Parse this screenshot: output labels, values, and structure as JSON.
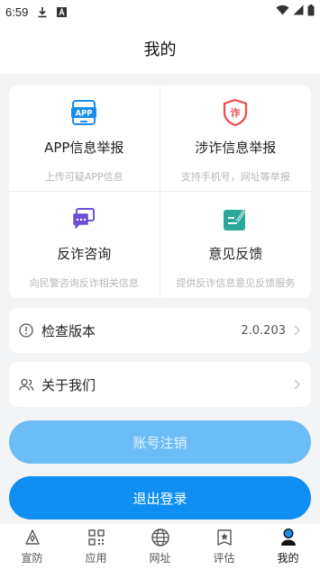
{
  "status_bar": {
    "time": "6:59",
    "icons": [
      "download-icon",
      "font-a-icon",
      "wifi-icon",
      "signal-icon",
      "battery-icon"
    ]
  },
  "header": {
    "title": "我的"
  },
  "grid": [
    {
      "icon": "app-report-icon",
      "title": "APP信息举报",
      "subtitle": "上传可疑APP信息",
      "color": "#1a8cf0"
    },
    {
      "icon": "fraud-shield-icon",
      "title": "涉诈信息举报",
      "subtitle": "支持手机号，网址等举报",
      "color": "#f04848"
    },
    {
      "icon": "chat-consult-icon",
      "title": "反诈咨询",
      "subtitle": "向民警咨询反诈相关信息",
      "color": "#6c4fd6"
    },
    {
      "icon": "feedback-edit-icon",
      "title": "意见反馈",
      "subtitle": "提供反诈信息意见反馈服务",
      "color": "#2aa89a"
    }
  ],
  "rows": {
    "version": {
      "label": "检查版本",
      "value": "2.0.203",
      "icon": "info-circle-icon"
    },
    "about": {
      "label": "关于我们",
      "icon": "people-icon"
    }
  },
  "buttons": {
    "cancel_account": "账号注销",
    "logout": "退出登录"
  },
  "tabs": [
    {
      "label": "宣防",
      "icon": "megaphone-icon",
      "active": false
    },
    {
      "label": "应用",
      "icon": "apps-grid-icon",
      "active": false
    },
    {
      "label": "网址",
      "icon": "globe-icon",
      "active": false
    },
    {
      "label": "评估",
      "icon": "star-badge-icon",
      "active": false
    },
    {
      "label": "我的",
      "icon": "user-icon",
      "active": true
    }
  ],
  "colors": {
    "accent": "#0f8ff1",
    "accent_light": "#6cbcf6",
    "background": "#f3f4f6"
  }
}
